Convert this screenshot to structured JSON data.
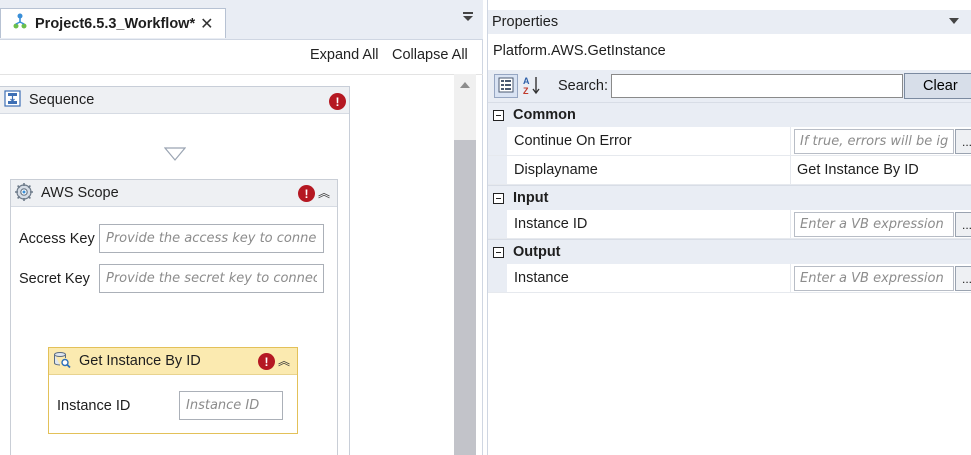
{
  "designer": {
    "tab_title": "Project6.5.3_Workflow*",
    "tab_close": "✕",
    "expand_all": "Expand All",
    "collapse_all": "Collapse All",
    "sequence": {
      "title": "Sequence",
      "error_badge": "!"
    },
    "aws_scope": {
      "title": "AWS Scope",
      "error_badge": "!",
      "collapse_glyph": "︽",
      "access_key_label": "Access Key",
      "access_key_placeholder": "Provide the access key to connect",
      "secret_key_label": "Secret Key",
      "secret_key_placeholder": "Provide the secret key to connect"
    },
    "get_instance": {
      "title": "Get Instance By ID",
      "error_badge": "!",
      "collapse_glyph": "︽",
      "instance_id_label": "Instance ID",
      "instance_id_placeholder": "Instance ID"
    }
  },
  "properties": {
    "title": "Properties",
    "activity_type": "Platform.AWS.GetInstance",
    "search_label": "Search:",
    "search_value": "",
    "clear_label": "Clear",
    "categories": [
      {
        "name": "Common",
        "rows": [
          {
            "name": "Continue On Error",
            "placeholder": "If true, errors will be ignored",
            "value": ""
          },
          {
            "name": "Displayname",
            "placeholder": "",
            "value": "Get Instance By ID"
          }
        ]
      },
      {
        "name": "Input",
        "rows": [
          {
            "name": "Instance ID",
            "placeholder": "Enter a VB expression",
            "value": ""
          }
        ]
      },
      {
        "name": "Output",
        "rows": [
          {
            "name": "Instance",
            "placeholder": "Enter a VB expression",
            "value": ""
          }
        ]
      }
    ],
    "ellipsis": "..."
  },
  "colors": {
    "error_badge": "#b51822",
    "activity_header": "#fbeab0",
    "panel_header": "#e9edf4"
  },
  "icons": {
    "tab": "workflow-icon",
    "sequence": "sequence-icon",
    "aws_scope": "gear-scope-icon",
    "get_instance": "search-database-icon",
    "categorized": "categorized-icon",
    "alphabetical": "sort-az-icon"
  }
}
